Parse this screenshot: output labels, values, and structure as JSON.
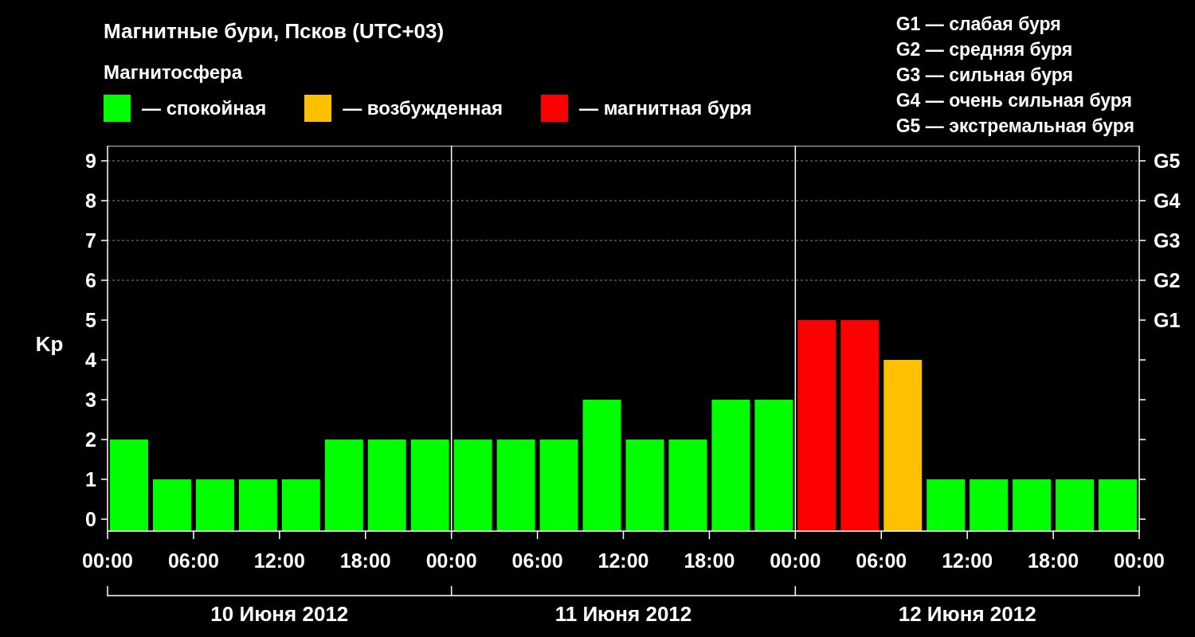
{
  "title": "Магнитные бури, Псков (UTC+03)",
  "legend": {
    "title": "Магнитосфера",
    "items": [
      {
        "label": "— спокойная",
        "color": "#00ff00"
      },
      {
        "label": "— возбужденная",
        "color": "#ffc000"
      },
      {
        "label": "— магнитная буря",
        "color": "#ff0000"
      }
    ]
  },
  "scale": [
    "G1 — слабая буря",
    "G2 — средняя буря",
    "G3 — сильная буря",
    "G4 — очень сильная буря",
    "G5 — экстремальная буря"
  ],
  "chart": {
    "time_labels": [
      "00:00",
      "06:00",
      "12:00",
      "18:00",
      "00:00",
      "06:00",
      "12:00",
      "18:00",
      "00:00",
      "06:00",
      "12:00",
      "18:00",
      "00:00"
    ],
    "chart_data": {
      "type": "bar",
      "ylabel": "Kp",
      "ylim": [
        0,
        9
      ],
      "yticks": [
        0,
        1,
        2,
        3,
        4,
        5,
        6,
        7,
        8,
        9
      ],
      "grid": true,
      "values": [
        2,
        1,
        1,
        1,
        1,
        2,
        2,
        2,
        2,
        2,
        2,
        3,
        2,
        2,
        3,
        3,
        5,
        5,
        4,
        1,
        1,
        1,
        1,
        1
      ]
    },
    "g_levels": [
      "G5",
      "G4",
      "G3",
      "G2",
      "G1"
    ],
    "days": [
      "10 Июня 2012",
      "11 Июня 2012",
      "12 Июня 2012"
    ]
  }
}
